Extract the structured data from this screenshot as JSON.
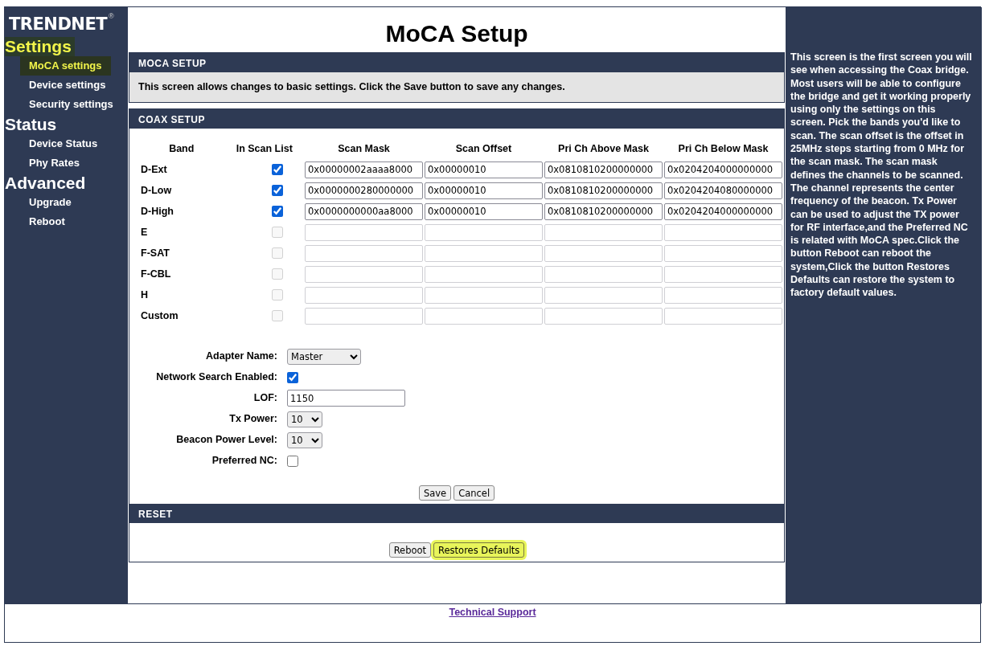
{
  "sidebar": {
    "logo": "TRENDNET",
    "logo_mark": "®",
    "groups": [
      {
        "title": "Settings",
        "highlighted": true,
        "items": [
          {
            "label": "MoCA settings",
            "selected": true
          },
          {
            "label": "Device settings",
            "selected": false
          },
          {
            "label": "Security settings",
            "selected": false
          }
        ]
      },
      {
        "title": "Status",
        "highlighted": false,
        "items": [
          {
            "label": "Device Status",
            "selected": false
          },
          {
            "label": "Phy Rates",
            "selected": false
          }
        ]
      },
      {
        "title": "Advanced",
        "highlighted": false,
        "items": [
          {
            "label": "Upgrade",
            "selected": false
          },
          {
            "label": "Reboot",
            "selected": false
          }
        ]
      }
    ]
  },
  "page_title": "MoCA Setup",
  "moca_setup": {
    "header": "MOCA SETUP",
    "description": "This screen allows changes to basic settings. Click the Save button to save any changes."
  },
  "coax_setup": {
    "header": "COAX SETUP",
    "columns": [
      "Band",
      "In Scan List",
      "Scan Mask",
      "Scan Offset",
      "Pri Ch Above Mask",
      "Pri Ch Below Mask"
    ],
    "rows": [
      {
        "band": "D-Ext",
        "checked": true,
        "disabled": false,
        "scan_mask": "0x00000002aaaa8000",
        "scan_offset": "0x00000010",
        "above_mask": "0x0810810200000000",
        "below_mask": "0x0204204000000000"
      },
      {
        "band": "D-Low",
        "checked": true,
        "disabled": false,
        "scan_mask": "0x0000000280000000",
        "scan_offset": "0x00000010",
        "above_mask": "0x0810810200000000",
        "below_mask": "0x0204204080000000"
      },
      {
        "band": "D-High",
        "checked": true,
        "disabled": false,
        "scan_mask": "0x0000000000aa8000",
        "scan_offset": "0x00000010",
        "above_mask": "0x0810810200000000",
        "below_mask": "0x0204204000000000"
      },
      {
        "band": "E",
        "checked": false,
        "disabled": true
      },
      {
        "band": "F-SAT",
        "checked": false,
        "disabled": true
      },
      {
        "band": "F-CBL",
        "checked": false,
        "disabled": true
      },
      {
        "band": "H",
        "checked": false,
        "disabled": true
      },
      {
        "band": "Custom",
        "checked": false,
        "disabled": true
      }
    ],
    "fields": [
      {
        "kind": "select",
        "label": "Adapter Name:",
        "value": "Master"
      },
      {
        "kind": "checkbox",
        "label": "Network Search Enabled:",
        "checked": true
      },
      {
        "kind": "text",
        "label": "LOF:",
        "value": "1150"
      },
      {
        "kind": "select",
        "label": "Tx Power:",
        "value": "10"
      },
      {
        "kind": "select",
        "label": "Beacon Power Level:",
        "value": "10"
      },
      {
        "kind": "checkbox",
        "label": "Preferred NC:",
        "checked": false
      }
    ],
    "buttons": [
      {
        "label": "Save",
        "highlighted": false
      },
      {
        "label": "Cancel",
        "highlighted": false
      }
    ]
  },
  "reset": {
    "header": "RESET",
    "buttons": [
      {
        "label": "Reboot",
        "highlighted": false
      },
      {
        "label": "Restores Defaults",
        "highlighted": true
      }
    ]
  },
  "help_text": "This screen is the first screen you will see when accessing the Coax bridge. Most users will be able to configure the bridge and get it working properly using only the settings on this screen. Pick the bands you'd like to scan. The scan offset is the offset in 25MHz steps starting from 0 MHz for the scan mask. The scan mask defines the channels to be scanned. The channel represents the center frequency of the beacon. Tx Power can be used to adjust the TX power for RF interface,and the Preferred NC is related with MoCA spec.Click the button Reboot can reboot the system,Click the button Restores Defaults can restore the system to factory default values.",
  "footer": {
    "link": "Technical Support"
  }
}
